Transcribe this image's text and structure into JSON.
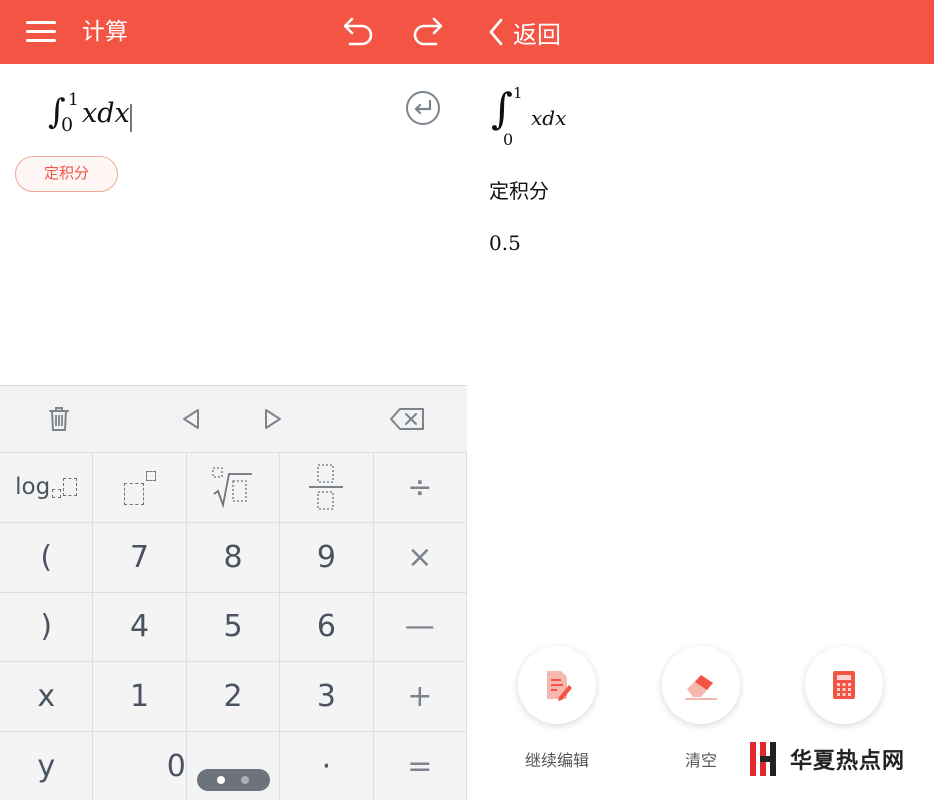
{
  "left": {
    "title": "计算",
    "expression": {
      "integral": "∫",
      "upper": "1",
      "lower": "0",
      "body": "xdx"
    },
    "chip_label": "定积分",
    "keyboard": {
      "rows": [
        [
          {
            "label": "log",
            "name": "key-log"
          },
          {
            "label": "",
            "name": "key-power"
          },
          {
            "label": "",
            "name": "key-root"
          },
          {
            "label": "",
            "name": "key-fraction"
          },
          {
            "label": "÷",
            "name": "key-divide"
          }
        ],
        [
          {
            "label": "(",
            "name": "key-left-paren"
          },
          {
            "label": "7",
            "name": "key-7"
          },
          {
            "label": "8",
            "name": "key-8"
          },
          {
            "label": "9",
            "name": "key-9"
          },
          {
            "label": "×",
            "name": "key-multiply"
          }
        ],
        [
          {
            "label": ")",
            "name": "key-right-paren"
          },
          {
            "label": "4",
            "name": "key-4"
          },
          {
            "label": "5",
            "name": "key-5"
          },
          {
            "label": "6",
            "name": "key-6"
          },
          {
            "label": "—",
            "name": "key-minus"
          }
        ],
        [
          {
            "label": "x",
            "name": "key-x"
          },
          {
            "label": "1",
            "name": "key-1"
          },
          {
            "label": "2",
            "name": "key-2"
          },
          {
            "label": "3",
            "name": "key-3"
          },
          {
            "label": "+",
            "name": "key-plus"
          }
        ],
        [
          {
            "label": "y",
            "name": "key-y"
          },
          {
            "label": "0",
            "name": "key-0"
          },
          {
            "label": "",
            "name": "key-blank"
          },
          {
            "label": "·",
            "name": "key-decimal"
          },
          {
            "label": "=",
            "name": "key-equals"
          }
        ]
      ]
    }
  },
  "right": {
    "back_label": "返回",
    "expression": {
      "integral": "∫",
      "upper": "1",
      "lower": "0",
      "body": "xdx"
    },
    "result_type": "定积分",
    "result_value": "0.5",
    "actions": [
      {
        "label": "继续编辑"
      },
      {
        "label": "清空"
      },
      {
        "label": ""
      }
    ]
  },
  "brand_text": "华夏热点网",
  "colors": {
    "accent": "#f35443",
    "key_text": "#4a5460",
    "keyboard_bg": "#f2f2f3"
  }
}
